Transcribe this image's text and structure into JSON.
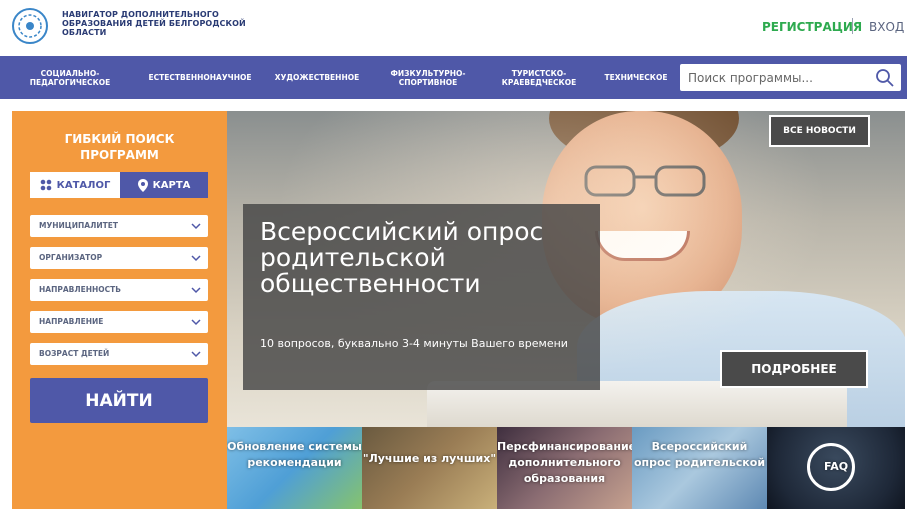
{
  "header": {
    "brand_lines": [
      "НАВИГАТОР ДОПОЛНИТЕЛЬНОГО",
      "ОБРАЗОВАНИЯ ДЕТЕЙ БЕЛГОРОДСКОЙ",
      "ОБЛАСТИ"
    ],
    "register_label": "РЕГИСТРАЦИЯ",
    "login_label": "ВХОД"
  },
  "nav": {
    "items": [
      {
        "label": "СОЦИАЛЬНО-\nПЕДАГОГИЧЕСКОЕ"
      },
      {
        "label": "ЕСТЕСТВЕННОНАУЧНОЕ"
      },
      {
        "label": "ХУДОЖЕСТВЕННОЕ"
      },
      {
        "label": "ФИЗКУЛЬТУРНО-\nСПОРТИВНОЕ"
      },
      {
        "label": "ТУРИСТСКО-\nКРАЕВЕДЧЕСКОЕ"
      },
      {
        "label": "ТЕХНИЧЕСКОЕ"
      }
    ],
    "search_placeholder": "Поиск программы..."
  },
  "filter": {
    "title_lines": [
      "ГИБКИЙ ПОИСК",
      "ПРОГРАММ"
    ],
    "tab_catalog": "КАТАЛОГ",
    "tab_map": "КАРТА",
    "selects": [
      "МУНИЦИПАЛИТЕТ",
      "ОРГАНИЗАТОР",
      "НАПРАВЛЕННОСТЬ",
      "НАПРАВЛЕНИЕ",
      "ВОЗРАСТ ДЕТЕЙ"
    ],
    "find_label": "НАЙТИ"
  },
  "hero": {
    "news_label": "ВСЕ НОВОСТИ",
    "title": "Всероссийский опрос родительской общественности",
    "subtitle": "10 вопросов, буквально 3-4 минуты Вашего времени",
    "more_label": "ПОДРОБНЕЕ"
  },
  "thumbnails": [
    {
      "text": "Обновление системы рекомендации"
    },
    {
      "text": "\"Лучшие из лучших\""
    },
    {
      "text": "Персфинансирование дополнительного образования"
    },
    {
      "text": "Всероссийский опрос родительской"
    },
    {
      "text": "FAQ"
    }
  ],
  "colors": {
    "nav": "#4f58a8",
    "panel": "#f39a3e",
    "register": "#2eaa4f"
  }
}
